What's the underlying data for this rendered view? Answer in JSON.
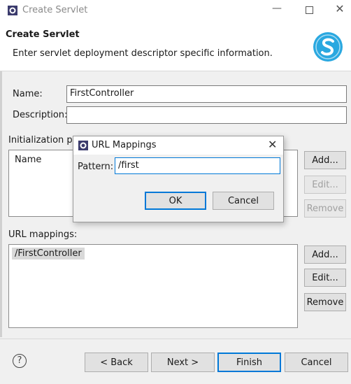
{
  "window": {
    "title": "Create Servlet"
  },
  "header": {
    "title": "Create Servlet",
    "description": "Enter servlet deployment descriptor specific information."
  },
  "form": {
    "name_label": "Name:",
    "name_value": "FirstController",
    "description_label": "Description:",
    "description_value": "",
    "init_params_label": "Initialization pa",
    "init_params_column": "Name",
    "url_mappings_label": "URL mappings:",
    "url_mappings": [
      "/FirstController"
    ]
  },
  "init_buttons": {
    "add": "Add...",
    "edit": "Edit...",
    "remove": "Remove"
  },
  "url_buttons": {
    "add": "Add...",
    "edit": "Edit...",
    "remove": "Remove"
  },
  "popup": {
    "title": "URL Mappings",
    "pattern_label": "Pattern:",
    "pattern_value": "/first",
    "ok": "OK",
    "cancel": "Cancel"
  },
  "footer": {
    "help_glyph": "?",
    "back": "< Back",
    "next": "Next >",
    "finish": "Finish",
    "cancel": "Cancel"
  },
  "colors": {
    "accent": "#0078d7",
    "logo": "#2aa8e0"
  }
}
